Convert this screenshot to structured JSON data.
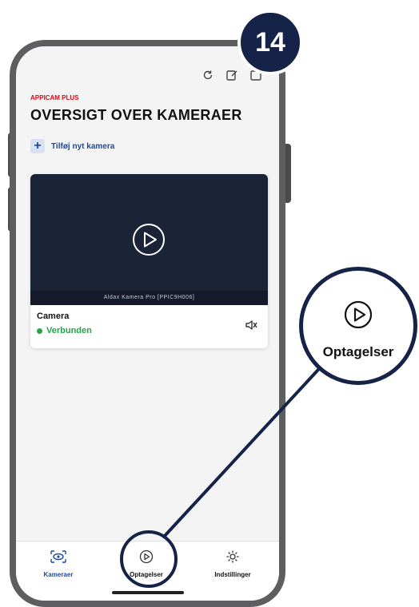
{
  "step": {
    "number": "14"
  },
  "app": {
    "kicker": "APPICAM PLUS",
    "title": "OVERSIGT OVER KAMERAER",
    "add_camera_label": "Tilføj nyt kamera"
  },
  "camera": {
    "device_label": "Aldax Kamera Pro [PPIC9H006]",
    "name": "Camera",
    "status": "Verbunden"
  },
  "tabs": [
    {
      "label": "Kameraer",
      "icon": "eye-icon",
      "active": true
    },
    {
      "label": "Optagelser",
      "icon": "play-circle-icon",
      "active": false
    },
    {
      "label": "Indstillinger",
      "icon": "gear-icon",
      "active": false
    }
  ],
  "callout": {
    "label": "Optagelser",
    "icon": "play-circle-icon"
  },
  "colors": {
    "brand_red": "#e30613",
    "accent_blue": "#1e4aa0",
    "navy": "#142347",
    "status_green": "#27a24a",
    "preview_bg": "#1b2337"
  }
}
